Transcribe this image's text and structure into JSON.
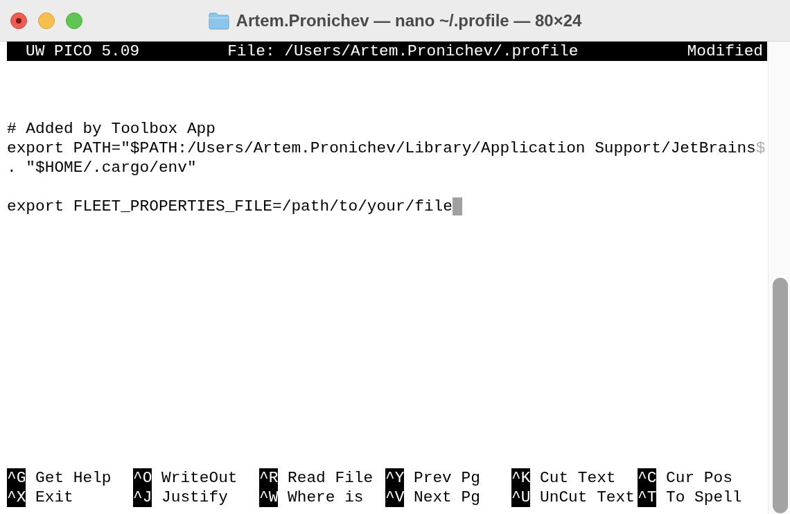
{
  "window": {
    "title": "Artem.Pronichev — nano ~/.profile — 80×24"
  },
  "header": {
    "app": "UW PICO 5.09",
    "file": "File: /Users/Artem.Pronichev/.profile",
    "status": "Modified"
  },
  "editor": {
    "blocks": [
      [
        {
          "text": "# Added by Toolbox App"
        },
        {
          "text": "export PATH=\"$PATH:/Users/Artem.Pronichev/Library/Application Support/JetBrains",
          "continuation": "$"
        },
        {
          "text": ". \"$HOME/.cargo/env\""
        }
      ],
      [
        {
          "text": "export FLEET_PROPERTIES_FILE=/path/to/your/file",
          "cursor": true
        }
      ]
    ]
  },
  "shortcuts": [
    [
      {
        "key": "^G",
        "label": "Get Help"
      },
      {
        "key": "^O",
        "label": "WriteOut"
      },
      {
        "key": "^R",
        "label": "Read File"
      },
      {
        "key": "^Y",
        "label": "Prev Pg"
      },
      {
        "key": "^K",
        "label": "Cut Text"
      },
      {
        "key": "^C",
        "label": "Cur Pos"
      }
    ],
    [
      {
        "key": "^X",
        "label": "Exit"
      },
      {
        "key": "^J",
        "label": "Justify"
      },
      {
        "key": "^W",
        "label": "Where is"
      },
      {
        "key": "^V",
        "label": "Next Pg"
      },
      {
        "key": "^U",
        "label": "UnCut Text"
      },
      {
        "key": "^T",
        "label": "To Spell"
      }
    ]
  ]
}
